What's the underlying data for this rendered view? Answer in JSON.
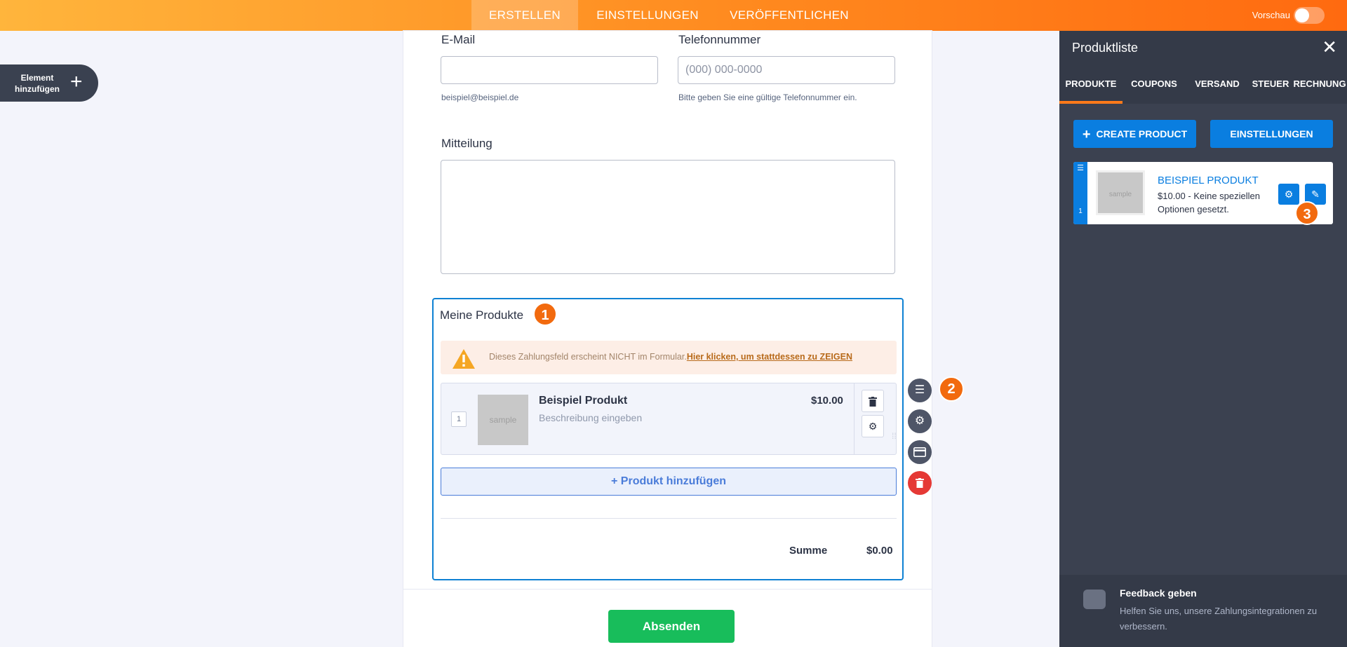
{
  "topbar": {
    "tabs": [
      {
        "label": "ERSTELLEN",
        "active": true
      },
      {
        "label": "EINSTELLUNGEN",
        "active": false
      },
      {
        "label": "VERÖFFENTLICHEN",
        "active": false
      }
    ],
    "preview_label": "Vorschau",
    "preview_on": false
  },
  "add_element": {
    "label": "Element hinzufügen"
  },
  "form": {
    "email": {
      "label": "E-Mail",
      "value": "",
      "sublabel": "beispiel@beispiel.de"
    },
    "phone": {
      "label": "Telefonnummer",
      "placeholder": "(000) 000-0000",
      "sublabel": "Bitte geben Sie eine gültige Telefonnummer ein."
    },
    "message": {
      "label": "Mitteilung",
      "value": ""
    },
    "products": {
      "title": "Meine Produkte",
      "badge": "1",
      "warning_text": "Dieses Zahlungsfeld erscheint NICHT im Formular.",
      "warning_link": "Hier klicken, um stattdessen zu ZEIGEN",
      "items": [
        {
          "number": "1",
          "image_text": "sample",
          "name": "Beispiel Produkt",
          "description": "Beschreibung eingeben",
          "price": "$10.00"
        }
      ],
      "add_label": "+ Produkt hinzufügen",
      "sum_label": "Summe",
      "sum_value": "$0.00"
    },
    "tools_badge": "2",
    "submit_label": "Absenden"
  },
  "panel": {
    "title": "Produktliste",
    "tabs": [
      {
        "label": "PRODUKTE",
        "active": true
      },
      {
        "label": "COUPONS",
        "active": false
      },
      {
        "label": "VERSAND",
        "active": false
      },
      {
        "label": "STEUER",
        "active": false
      },
      {
        "label": "RECHNUNG",
        "active": false
      }
    ],
    "create_label": "CREATE PRODUCT",
    "settings_label": "EINSTELLUNGEN",
    "product": {
      "number": "1",
      "image_text": "sample",
      "name": "BEISPIEL PRODUKT",
      "description": "$10.00 - Keine speziellen Optionen gesetzt.",
      "badge": "3"
    },
    "feedback": {
      "title": "Feedback geben",
      "text": "Helfen Sie uns, unsere Zahlungsintegrationen zu verbessern."
    }
  },
  "colors": {
    "accent_orange": "#ff7a1a",
    "primary_blue": "#0a7ee0",
    "submit_green": "#18bd5b",
    "delete_red": "#e53935",
    "panel_bg": "#3b4150"
  },
  "icons": [
    "plus-icon",
    "close-icon",
    "warning-icon",
    "trash-icon",
    "gear-icon",
    "list-icon",
    "payment-icon",
    "pencil-icon",
    "chat-icon",
    "drag-handle-icon"
  ]
}
